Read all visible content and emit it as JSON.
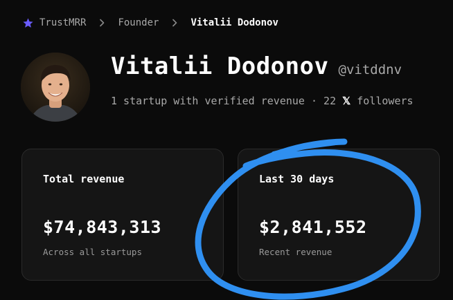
{
  "breadcrumb": {
    "icon": "star-icon",
    "accent": "#6a5cff",
    "items": [
      "TrustMRR",
      "Founder",
      "Vitalii Dodonov"
    ]
  },
  "profile": {
    "name": "Vitalii Dodonov",
    "handle": "@vitddnv",
    "meta_prefix": "1 startup with verified revenue · 22",
    "x_logo": "𝕏",
    "meta_suffix": "followers"
  },
  "stats": [
    {
      "label": "Total revenue",
      "value": "$74,843,313",
      "sub": "Across all startups"
    },
    {
      "label": "Last 30 days",
      "value": "$2,841,552",
      "sub": "Recent revenue"
    }
  ],
  "annotation": {
    "color": "#2f8ff0"
  }
}
